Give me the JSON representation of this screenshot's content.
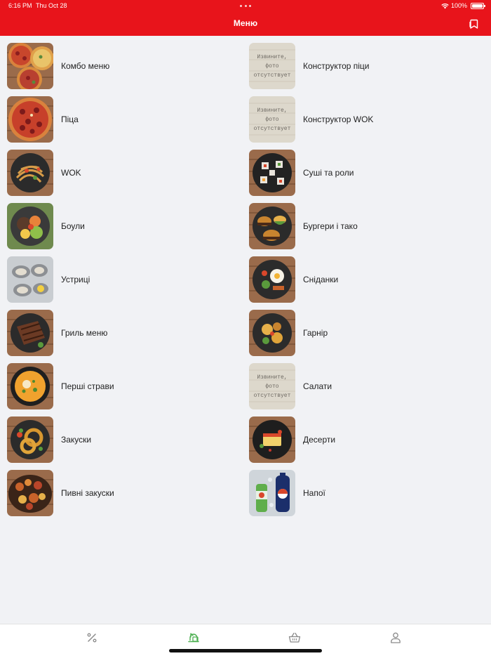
{
  "status_bar": {
    "time": "6:16 PM",
    "date": "Thu Oct 28",
    "battery": "100%"
  },
  "header": {
    "title": "Меню"
  },
  "colors": {
    "brand": "#e8141b",
    "active_tab": "#4caf50",
    "inactive_tab": "#8a8a8a"
  },
  "menu": {
    "left": [
      {
        "label": "Комбо меню",
        "image": "pizza-combo"
      },
      {
        "label": "Піца",
        "image": "pizza"
      },
      {
        "label": "WOK",
        "image": "wok-noodles"
      },
      {
        "label": "Боули",
        "image": "bowl"
      },
      {
        "label": "Устриці",
        "image": "oysters"
      },
      {
        "label": "Гриль меню",
        "image": "grill-steak"
      },
      {
        "label": "Перші страви",
        "image": "soup"
      },
      {
        "label": "Закуски",
        "image": "onion-rings"
      },
      {
        "label": "Пивні закуски",
        "image": "beer-snacks"
      }
    ],
    "right": [
      {
        "label": "Конструктор піци",
        "image": "no-photo",
        "placeholder_text": [
          "Извините,",
          "фото",
          "отсутствует"
        ]
      },
      {
        "label": "Конструктор WOK",
        "image": "no-photo",
        "placeholder_text": [
          "Извините,",
          "фото",
          "отсутствует"
        ]
      },
      {
        "label": "Суші та роли",
        "image": "sushi"
      },
      {
        "label": "Бургери і тако",
        "image": "burgers"
      },
      {
        "label": "Сніданки",
        "image": "breakfast"
      },
      {
        "label": "Гарнір",
        "image": "side-dish"
      },
      {
        "label": "Салати",
        "image": "no-photo",
        "placeholder_text": [
          "Извините,",
          "фото",
          "отсутствует"
        ]
      },
      {
        "label": "Десерти",
        "image": "dessert"
      },
      {
        "label": "Напої",
        "image": "drinks"
      }
    ]
  },
  "tabbar": {
    "items": [
      {
        "name": "promotions",
        "icon": "percent-icon",
        "active": false
      },
      {
        "name": "menu",
        "icon": "menu-tray-icon",
        "active": true
      },
      {
        "name": "cart",
        "icon": "basket-icon",
        "active": false
      },
      {
        "name": "profile",
        "icon": "user-icon",
        "active": false
      }
    ]
  }
}
